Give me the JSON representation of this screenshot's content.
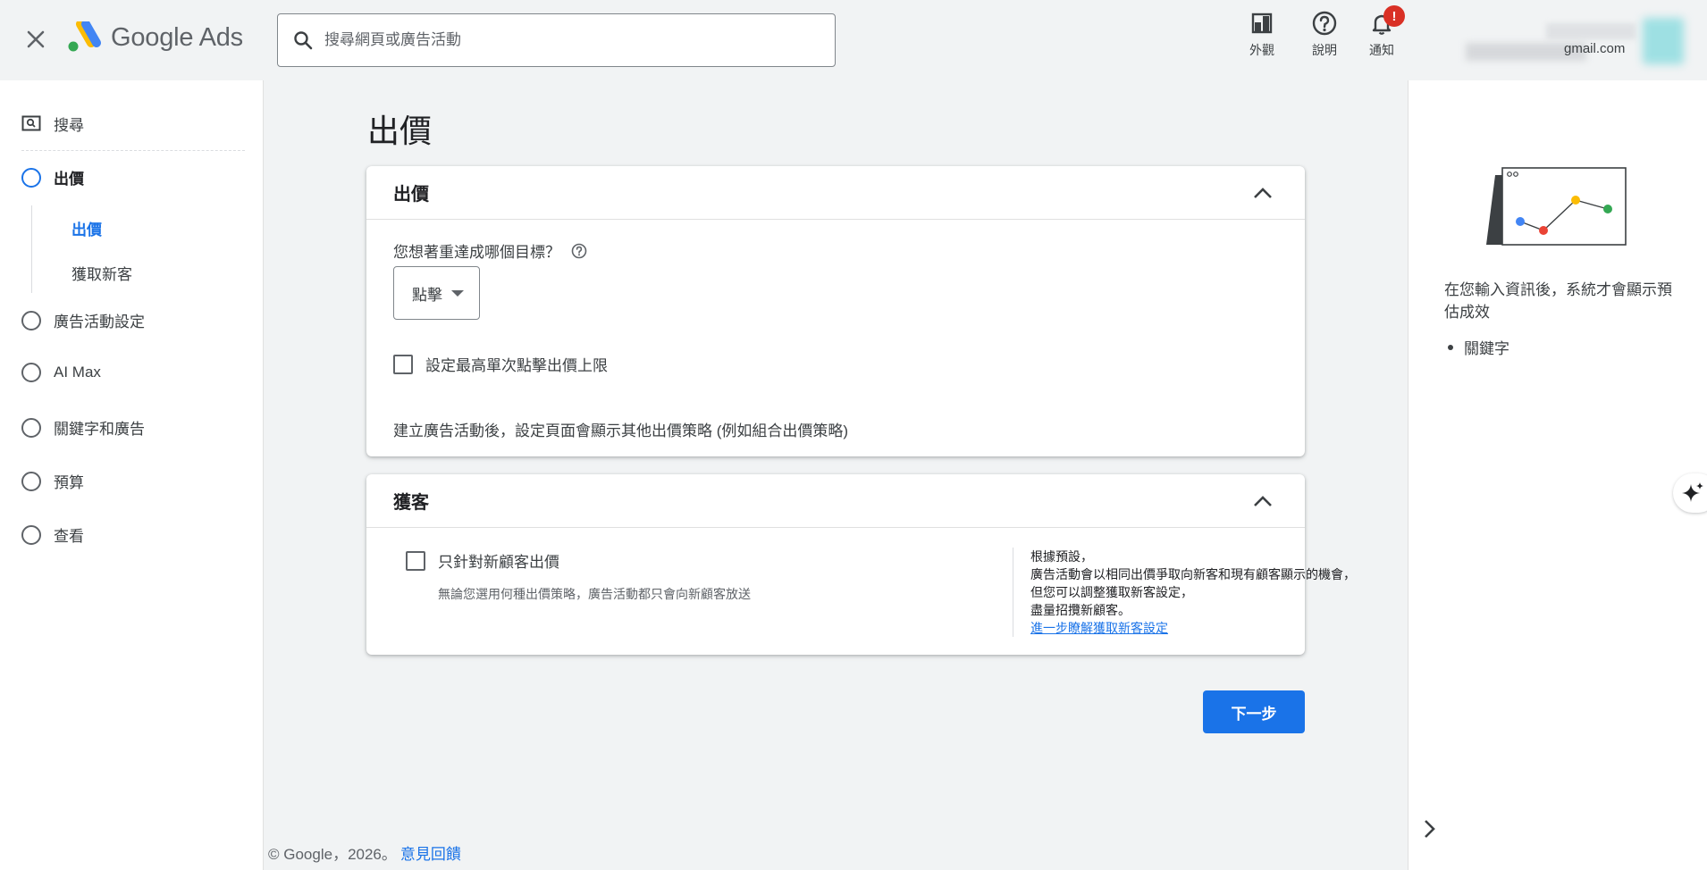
{
  "header": {
    "logo_text": "Google Ads",
    "search_placeholder": "搜尋網頁或廣告活動",
    "appearance_label": "外觀",
    "help_label": "說明",
    "notifications_label": "通知",
    "notifications_badge": "!",
    "account_email": "gmail.com"
  },
  "sidebar": {
    "search_label": "搜尋",
    "items": [
      {
        "label": "出價",
        "active": true
      },
      {
        "label": "廣告活動設定"
      },
      {
        "label": "AI Max"
      },
      {
        "label": "關鍵字和廣告"
      },
      {
        "label": "預算"
      },
      {
        "label": "查看"
      }
    ],
    "sub_items": [
      {
        "label": "出價",
        "active": true
      },
      {
        "label": "獲取新客"
      }
    ]
  },
  "main": {
    "page_title": "出價",
    "bidding_card": {
      "title": "出價",
      "question": "您想著重達成哪個目標？",
      "dropdown_value": "點擊",
      "checkbox_label": "設定最高單次點擊出價上限",
      "note": "建立廣告活動後，設定頁面會顯示其他出價策略 (例如組合出價策略)"
    },
    "acquisition_card": {
      "title": "獲客",
      "checkbox_label": "只針對新顧客出價",
      "checkbox_sub": "無論您選用何種出價策略，廣告活動都只會向新顧客放送",
      "info_lines": [
        "根據預設，",
        "廣告活動會以相同出價爭取向新客和現有顧客顯示的機會，",
        "但您可以調整獲取新客設定，",
        "盡量招攬新顧客。"
      ],
      "info_link": "進一步瞭解獲取新客設定"
    },
    "next_button": "下一步"
  },
  "footer": {
    "copyright": "© Google，2026。",
    "feedback": "意見回饋"
  },
  "right_panel": {
    "message": "在您輸入資訊後，系統才會顯示預估成效",
    "bullet": "關鍵字"
  },
  "colors": {
    "accent": "#1a73e8",
    "badge": "#d93025",
    "chart_blue": "#4285f4",
    "chart_red": "#ea4335",
    "chart_yellow": "#fbbc04",
    "chart_green": "#34a853"
  }
}
